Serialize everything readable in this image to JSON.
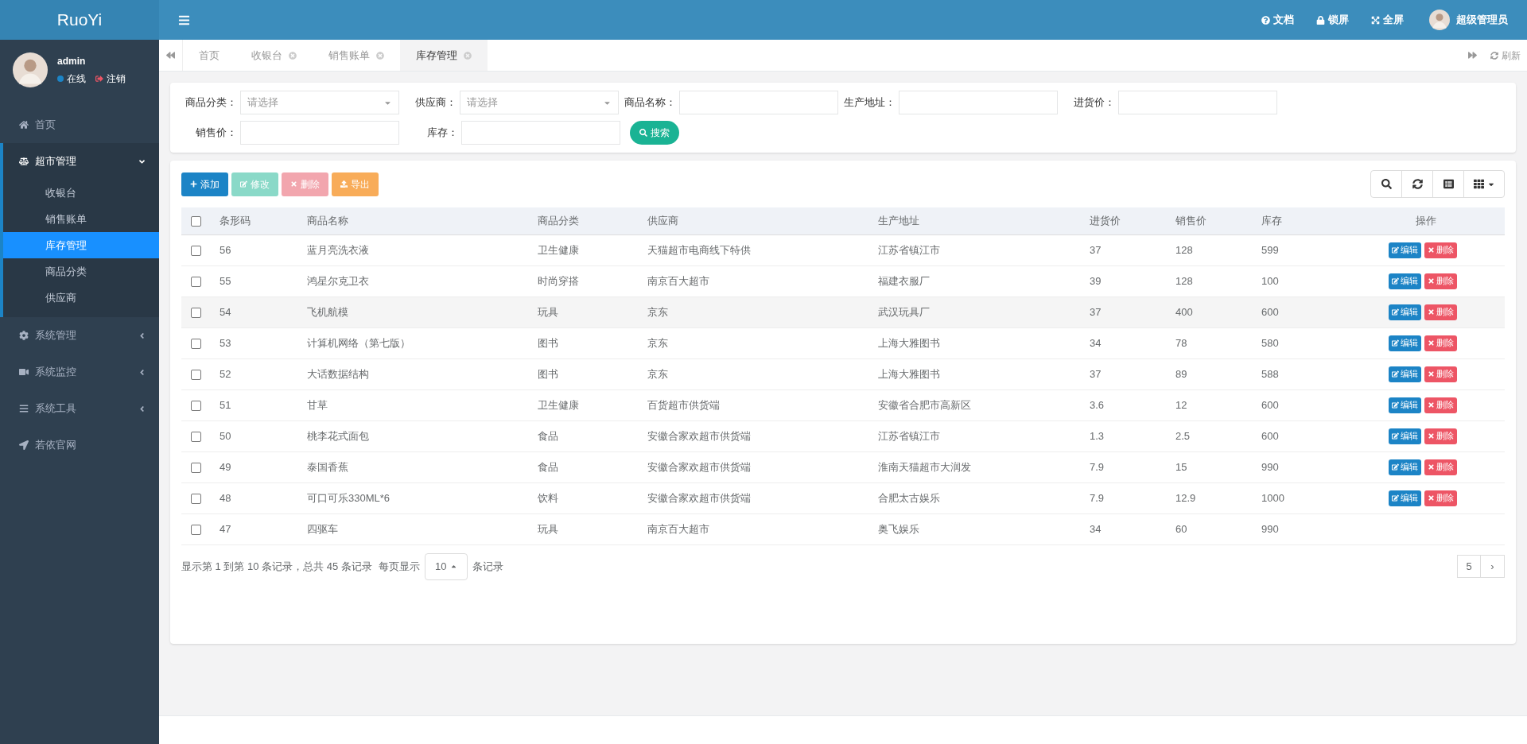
{
  "brand": "RuoYi",
  "header_links": [
    {
      "kind": "help",
      "label": "文档"
    },
    {
      "kind": "lock",
      "label": "锁屏"
    },
    {
      "kind": "fullscreen",
      "label": "全屏"
    }
  ],
  "user_menu": "超级管理员",
  "user": {
    "name": "admin",
    "status": "在线",
    "logout": "注销"
  },
  "sidebar": {
    "items": [
      {
        "kind": "home",
        "label": "首页",
        "expanded": false
      },
      {
        "kind": "scale",
        "label": "超市管理",
        "expanded": true,
        "children": [
          {
            "label": "收银台",
            "selected": false
          },
          {
            "label": "销售账单",
            "selected": false
          },
          {
            "label": "库存管理",
            "selected": true
          },
          {
            "label": "商品分类",
            "selected": false
          },
          {
            "label": "供应商",
            "selected": false
          }
        ]
      },
      {
        "kind": "gear",
        "label": "系统管理",
        "expanded": false
      },
      {
        "kind": "video",
        "label": "系统监控",
        "expanded": false
      },
      {
        "kind": "bars",
        "label": "系统工具",
        "expanded": false
      },
      {
        "kind": "send",
        "label": "若依官网",
        "expanded": false
      }
    ]
  },
  "tabs": [
    {
      "label": "首页",
      "selected": false,
      "closable": false
    },
    {
      "label": "收银台",
      "selected": false,
      "closable": true
    },
    {
      "label": "销售账单",
      "selected": false,
      "closable": true
    },
    {
      "label": "库存管理",
      "selected": true,
      "closable": true
    }
  ],
  "refresh": "刷新",
  "search_form": {
    "fields": [
      {
        "kind": "select",
        "label": "商品分类：",
        "placeholder": "请选择"
      },
      {
        "kind": "select",
        "label": "供应商：",
        "placeholder": "请选择"
      },
      {
        "kind": "input",
        "label": "商品名称："
      },
      {
        "kind": "input",
        "label": "生产地址："
      },
      {
        "kind": "input",
        "label": "进货价："
      },
      {
        "kind": "input",
        "label": "销售价："
      },
      {
        "kind": "input",
        "label": "库存："
      }
    ],
    "button": "搜索"
  },
  "toolbar": [
    {
      "kind": "add",
      "label": "添加",
      "disabled": false
    },
    {
      "kind": "edit",
      "label": "修改",
      "disabled": true
    },
    {
      "kind": "delete",
      "label": "删除",
      "disabled": true
    },
    {
      "kind": "export",
      "label": "导出",
      "disabled": false
    }
  ],
  "table": {
    "select_all_checked": false,
    "columns": [
      "条形码",
      "商品名称",
      "商品分类",
      "供应商",
      "生产地址",
      "进货价",
      "销售价",
      "库存",
      "操作"
    ],
    "rows": [
      {
        "cells": [
          "56",
          "蓝月亮洗衣液",
          "卫生健康",
          "天猫超市电商线下特供",
          "江苏省镇江市",
          "37",
          "128",
          "599"
        ],
        "checked": false,
        "actions": [
          "编辑",
          "删除"
        ]
      },
      {
        "cells": [
          "55",
          "鸿星尔克卫衣",
          "时尚穿搭",
          "南京百大超市",
          "福建衣服厂",
          "39",
          "128",
          "100"
        ],
        "checked": false,
        "actions": [
          "编辑",
          "删除"
        ]
      },
      {
        "cells": [
          "54",
          "飞机航模",
          "玩具",
          "京东",
          "武汉玩具厂",
          "37",
          "400",
          "600"
        ],
        "checked": false,
        "actions": [
          "编辑",
          "删除"
        ]
      },
      {
        "cells": [
          "53",
          "计算机网络（第七版）",
          "图书",
          "京东",
          "上海大雅图书",
          "34",
          "78",
          "580"
        ],
        "checked": false,
        "actions": [
          "编辑",
          "删除"
        ]
      },
      {
        "cells": [
          "52",
          "大话数据结构",
          "图书",
          "京东",
          "上海大雅图书",
          "37",
          "89",
          "588"
        ],
        "checked": false,
        "actions": [
          "编辑",
          "删除"
        ]
      },
      {
        "cells": [
          "51",
          "甘草",
          "卫生健康",
          "百货超市供货端",
          "安徽省合肥市高新区",
          "3.6",
          "12",
          "600"
        ],
        "checked": false,
        "actions": [
          "编辑",
          "删除"
        ]
      },
      {
        "cells": [
          "50",
          "桃李花式面包",
          "食品",
          "安徽合家欢超市供货端",
          "江苏省镇江市",
          "1.3",
          "2.5",
          "600"
        ],
        "checked": false,
        "actions": [
          "编辑",
          "删除"
        ]
      },
      {
        "cells": [
          "49",
          "泰国香蕉",
          "食品",
          "安徽合家欢超市供货端",
          "淮南天猫超市大润发",
          "7.9",
          "15",
          "990"
        ],
        "checked": false,
        "actions": [
          "编辑",
          "删除"
        ]
      },
      {
        "cells": [
          "48",
          "可口可乐330ML*6",
          "饮料",
          "安徽合家欢超市供货端",
          "合肥太古娱乐",
          "7.9",
          "12.9",
          "1000"
        ],
        "checked": false,
        "actions": [
          "编辑",
          "删除"
        ]
      },
      {
        "cells": [
          "47",
          "四驱车",
          "玩具",
          "南京百大超市",
          "奥飞娱乐",
          "34",
          "60",
          "990"
        ],
        "checked": false
      }
    ]
  },
  "pagination": {
    "summary_1": "显示第 1 到第 10 条记录，总共 45 条记录",
    "summary_2": "每页显示",
    "page_size": "10",
    "summary_3": "条记录",
    "pages": [
      {
        "label": "5",
        "selected": false
      }
    ],
    "next": "›"
  }
}
